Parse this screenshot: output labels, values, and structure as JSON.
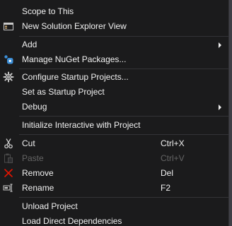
{
  "colors": {
    "background": "#1b1b1c",
    "text": "#f1f1f1",
    "disabled_text": "#656565",
    "separator": "#333337",
    "nuget_blue": "#3c8fd8",
    "remove_red": "#e51400"
  },
  "menu": {
    "items": [
      {
        "label": "Scope to This"
      },
      {
        "label": "New Solution Explorer View",
        "icon": "solution-explorer-icon"
      },
      {
        "label": "Add",
        "submenu": true
      },
      {
        "label": "Manage NuGet Packages...",
        "icon": "nuget-icon"
      },
      {
        "label": "Configure Startup Projects...",
        "icon": "gear-icon"
      },
      {
        "label": "Set as Startup Project"
      },
      {
        "label": "Debug",
        "submenu": true
      },
      {
        "label": "Initialize Interactive with Project"
      },
      {
        "label": "Cut",
        "shortcut": "Ctrl+X",
        "icon": "scissors-icon"
      },
      {
        "label": "Paste",
        "shortcut": "Ctrl+V",
        "icon": "paste-icon",
        "disabled": true
      },
      {
        "label": "Remove",
        "shortcut": "Del",
        "icon": "remove-icon"
      },
      {
        "label": "Rename",
        "shortcut": "F2",
        "icon": "rename-icon"
      },
      {
        "label": "Unload Project"
      },
      {
        "label": "Load Direct Dependencies"
      }
    ]
  }
}
